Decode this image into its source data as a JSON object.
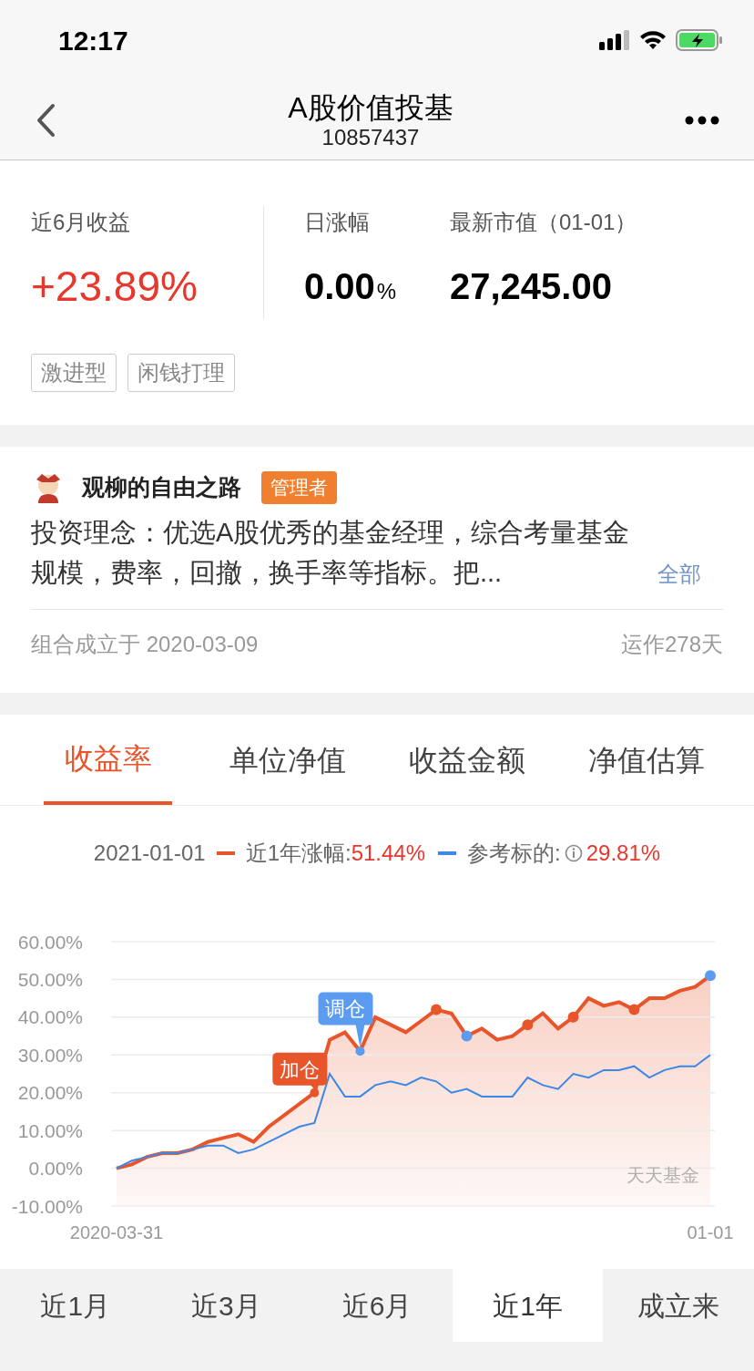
{
  "status_bar": {
    "time": "12:17"
  },
  "header": {
    "title": "A股价值投基",
    "subtitle": "10857437"
  },
  "summary": {
    "metrics": [
      {
        "label": "近6月收益",
        "value": "+23.89%",
        "kind": "gain"
      },
      {
        "label": "日涨幅",
        "value": "0.00",
        "unit": "%",
        "kind": "plain"
      },
      {
        "label": "最新市值（01-01）",
        "value": "27,245.00",
        "kind": "plain"
      }
    ],
    "tags": [
      "激进型",
      "闲钱打理"
    ]
  },
  "manager": {
    "name": "观柳的自由之路",
    "badge": "管理者",
    "description": "投资理念：优选A股优秀的基金经理，综合考量基金规模，费率，回撤，换手率等指标。把...",
    "more_link": "全部",
    "founded": "组合成立于 2020-03-09",
    "running": "运作278天"
  },
  "tabs": [
    {
      "label": "收益率",
      "selected": true
    },
    {
      "label": "单位净值",
      "selected": false
    },
    {
      "label": "收益金额",
      "selected": false
    },
    {
      "label": "净值估算",
      "selected": false
    }
  ],
  "legend": {
    "date": "2021-01-01",
    "items": [
      {
        "value": "51.44%"
      },
      {
        "value": "29.81%",
        "info": true
      }
    ]
  },
  "chart_data": {
    "type": "line",
    "grid": true,
    "ylim": [
      -10,
      60
    ],
    "yticks": [
      {
        "value": 60,
        "label": "60.00%"
      },
      {
        "value": 50,
        "label": "50.00%"
      },
      {
        "value": 40,
        "label": "40.00%"
      },
      {
        "value": 30,
        "label": "30.00%"
      },
      {
        "value": 20,
        "label": "20.00%"
      },
      {
        "value": 10,
        "label": "10.00%"
      },
      {
        "value": 0,
        "label": "0.00%"
      },
      {
        "value": -10,
        "label": "-10.00%"
      }
    ],
    "categories": [
      "2020-03-31",
      null,
      null,
      null,
      null,
      null,
      null,
      null,
      null,
      null,
      null,
      null,
      null,
      null,
      null,
      null,
      null,
      null,
      null,
      null,
      null,
      null,
      null,
      null,
      null,
      null,
      null,
      null,
      null,
      null,
      null,
      null,
      null,
      null,
      null,
      null,
      null,
      null,
      null,
      "01-01"
    ],
    "series": [
      {
        "name": "近1年涨幅:",
        "color": "#e8552a",
        "values": [
          0,
          1,
          3,
          4,
          4,
          5,
          7,
          8,
          9,
          7,
          11,
          14,
          17,
          20,
          34,
          36,
          31,
          40,
          38,
          36,
          39,
          42,
          41,
          35,
          37,
          34,
          35,
          38,
          41,
          37,
          40,
          45,
          43,
          44,
          42,
          45,
          45,
          47,
          48,
          51
        ]
      },
      {
        "name": "参考标的:",
        "color": "#3d87e6",
        "values": [
          0,
          2,
          3,
          4,
          4,
          5,
          6,
          6,
          4,
          5,
          7,
          9,
          11,
          12,
          25,
          19,
          19,
          22,
          23,
          22,
          24,
          23,
          20,
          21,
          19,
          19,
          19,
          24,
          22,
          21,
          25,
          24,
          26,
          26,
          27,
          24,
          26,
          27,
          27,
          30
        ]
      }
    ],
    "annotations": [
      "加仓",
      "调仓"
    ]
  },
  "chart_events": [
    {
      "color": "#e8552a"
    },
    {
      "color": "#5b9cf0"
    },
    {
      "color": "#e8552a"
    },
    {
      "color": "#5b9cf0"
    },
    {
      "color": "#e8552a"
    },
    {
      "color": "#e8552a"
    },
    {
      "color": "#e8552a"
    },
    {
      "color": "#5b9cf0"
    }
  ],
  "chart_watermark": "天天基金",
  "periods": [
    {
      "label": "近1月",
      "selected": false
    },
    {
      "label": "近3月",
      "selected": false
    },
    {
      "label": "近6月",
      "selected": false
    },
    {
      "label": "近1年",
      "selected": true
    },
    {
      "label": "成立来",
      "selected": false
    }
  ]
}
